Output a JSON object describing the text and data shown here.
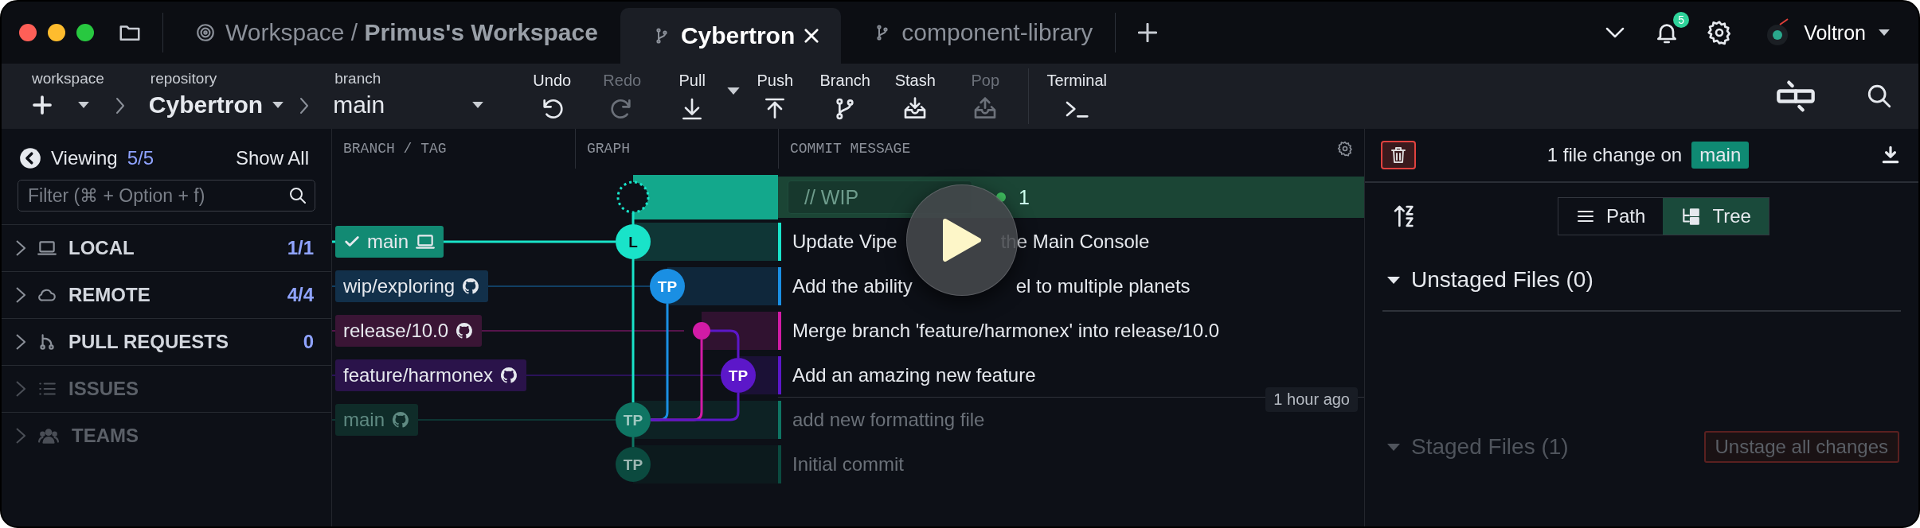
{
  "tabs": [
    {
      "label": "Workspace / **Primus's Workspace**",
      "kind": "workspace",
      "selected": false,
      "closable": false
    },
    {
      "label": "Cybertron",
      "kind": "repo",
      "selected": true,
      "closable": true
    },
    {
      "label": "component-library",
      "kind": "repo",
      "selected": false,
      "closable": false
    }
  ],
  "header": {
    "notifications": "5",
    "user": "Voltron"
  },
  "toolbar": {
    "workspace": {
      "caption": "workspace"
    },
    "repository": {
      "caption": "repository",
      "value": "Cybertron"
    },
    "branch": {
      "caption": "branch",
      "value": "main"
    },
    "actions": [
      {
        "label": "Undo",
        "kind": "undo",
        "disabled": false,
        "menu": false
      },
      {
        "label": "Redo",
        "kind": "redo",
        "disabled": true,
        "menu": false
      },
      {
        "label": "Pull",
        "kind": "pull",
        "disabled": false,
        "menu": true
      },
      {
        "label": "Push",
        "kind": "push",
        "disabled": false,
        "menu": false
      },
      {
        "label": "Branch",
        "kind": "branch",
        "disabled": false,
        "menu": false
      },
      {
        "label": "Stash",
        "kind": "stash",
        "disabled": false,
        "menu": false
      },
      {
        "label": "Pop",
        "kind": "pop",
        "disabled": true,
        "menu": false
      }
    ],
    "terminal": {
      "label": "Terminal"
    }
  },
  "sidebar": {
    "viewing_label": "Viewing",
    "viewing_count": "5/5",
    "show_all": "Show All",
    "filter_placeholder": "Filter (⌘ + Option + f)",
    "sections": [
      {
        "label": "LOCAL",
        "kind": "local",
        "count": "1/1",
        "expanded": false,
        "dimmed": false
      },
      {
        "label": "REMOTE",
        "kind": "remote",
        "count": "4/4",
        "expanded": false,
        "dimmed": false
      },
      {
        "label": "PULL REQUESTS",
        "kind": "pulls",
        "count": "0",
        "expanded": false,
        "dimmed": false
      },
      {
        "label": "ISSUES",
        "kind": "issues",
        "expanded": false,
        "dimmed": true
      },
      {
        "label": "TEAMS",
        "kind": "teams",
        "expanded": false,
        "dimmed": true
      }
    ]
  },
  "graph": {
    "columns": [
      "BRANCH / TAG",
      "GRAPH",
      "COMMIT MESSAGE"
    ],
    "rows": [
      {
        "kind": "wip",
        "message": "// WIP",
        "count": "1",
        "color": "#13a88c"
      },
      {
        "kind": "commit",
        "ref": {
          "name": "main",
          "kind": "local",
          "checked": true,
          "color": "#128a73"
        },
        "node": "L",
        "color": "#19e3c9",
        "message": "Update Vipe",
        "message_after": "the Main Console",
        "dimmed": false
      },
      {
        "kind": "commit",
        "ref": {
          "name": "wip/exploring",
          "kind": "remote",
          "checked": false,
          "color": "#12304a"
        },
        "node": "TP",
        "color": "#1a8fe3",
        "message": "Add the ability",
        "message_after": "el to multiple planets",
        "dimmed": false
      },
      {
        "kind": "merge",
        "ref": {
          "name": "release/10.0",
          "kind": "remote",
          "checked": false,
          "color": "#3a1535"
        },
        "color": "#d21ba6",
        "message": "Merge branch 'feature/harmonex' into release/10.0",
        "dimmed": false
      },
      {
        "kind": "commit",
        "ref": {
          "name": "feature/harmonex",
          "kind": "remote",
          "checked": false,
          "color": "#2a134a"
        },
        "node": "TP",
        "color": "#5c17c9",
        "message": "Add an amazing new feature",
        "time": "1 hour ago",
        "dimmed": false
      },
      {
        "kind": "commit",
        "ref": {
          "name": "main",
          "kind": "remote",
          "checked": false,
          "color": "#0f2c29"
        },
        "node": "TP",
        "color": "#0f7563",
        "message": "add new formatting file",
        "dimmed": true
      },
      {
        "kind": "commit",
        "node": "TP",
        "color": "#0b4a3f",
        "message": "Initial commit",
        "dimmed": true
      }
    ]
  },
  "panel": {
    "summary": "1 file change on",
    "branch": "main",
    "views": [
      {
        "label": "Path",
        "kind": "path",
        "selected": false
      },
      {
        "label": "Tree",
        "kind": "tree",
        "selected": true
      }
    ],
    "groups": [
      {
        "label": "Unstaged Files (0)",
        "expanded": true,
        "dimmed": false
      },
      {
        "label": "Staged Files (1)",
        "expanded": true,
        "dimmed": true,
        "action": "Unstage all changes"
      }
    ]
  }
}
